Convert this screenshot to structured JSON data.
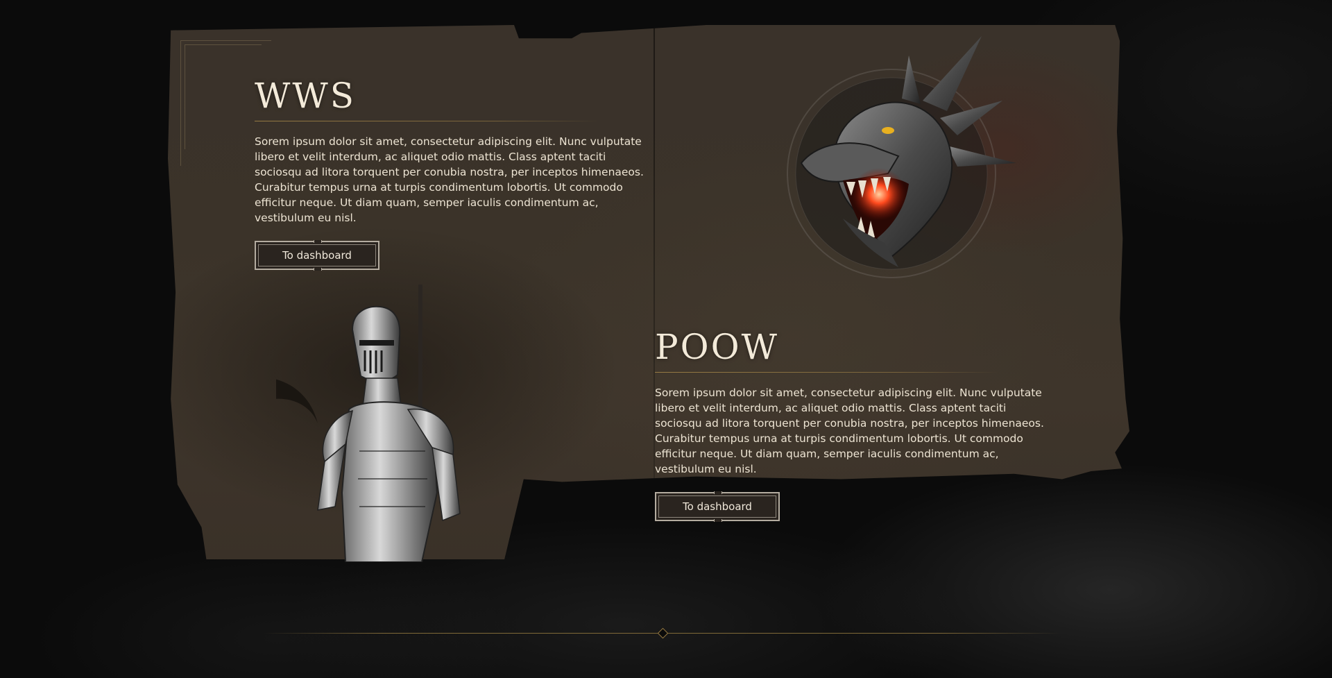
{
  "sections": [
    {
      "title": "WWS",
      "body": "Sorem ipsum dolor sit amet, consectetur adipiscing elit. Nunc vulputate libero et velit interdum, ac aliquet odio mattis. Class aptent taciti sociosqu ad litora torquent per conubia nostra, per inceptos himenaeos. Curabitur tempus urna at turpis condimentum lobortis. Ut commodo efficitur neque. Ut diam quam, semper iaculis condimentum ac, vestibulum eu nisl.",
      "button_label": "To dashboard"
    },
    {
      "title": "POOW",
      "body": "Sorem ipsum dolor sit amet, consectetur adipiscing elit. Nunc vulputate libero et velit interdum, ac aliquet odio mattis. Class aptent taciti sociosqu ad litora torquent per conubia nostra, per inceptos himenaeos. Curabitur tempus urna at turpis condimentum lobortis. Ut commodo efficitur neque. Ut diam quam, semper iaculis condimentum ac, vestibulum eu nisl.",
      "button_label": "To dashboard"
    }
  ],
  "icons": {
    "dragon": "dragon-emblem",
    "knight": "knight-armor-illustration",
    "divider": "diamond-divider"
  },
  "colors": {
    "parchment": "#3b3329",
    "title_text": "#f3ead9",
    "accent_gold": "#a08246",
    "button_border": "#b4aca0",
    "dragon_fire": "#ff3a1a"
  }
}
